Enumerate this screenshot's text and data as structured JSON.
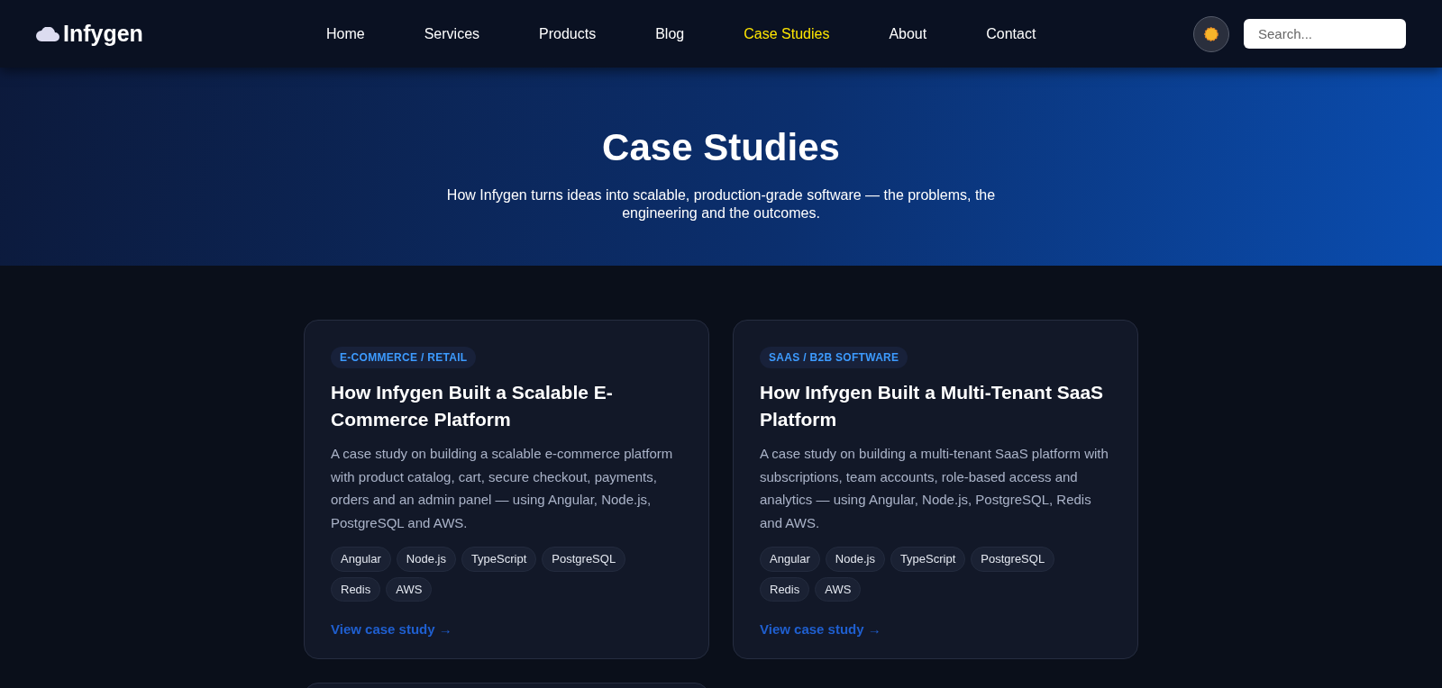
{
  "brand": {
    "name": "Infygen"
  },
  "nav": [
    {
      "label": "Home",
      "selected": false
    },
    {
      "label": "Services",
      "selected": false
    },
    {
      "label": "Products",
      "selected": false
    },
    {
      "label": "Blog",
      "selected": false
    },
    {
      "label": "Case Studies",
      "selected": true
    },
    {
      "label": "About",
      "selected": false
    },
    {
      "label": "Contact",
      "selected": false
    }
  ],
  "search": {
    "placeholder": "Search..."
  },
  "hero": {
    "title": "Case Studies",
    "subtitle": "How Infygen turns ideas into scalable, production-grade software — the problems, the engineering and the outcomes."
  },
  "cards": [
    {
      "category": "E-COMMERCE / RETAIL",
      "title": "How Infygen Built a Scalable E-Commerce Platform",
      "description": "A case study on building a scalable e-commerce platform with product catalog, cart, secure checkout, payments, orders and an admin panel — using Angular, Node.js, PostgreSQL and AWS.",
      "tags": [
        "Angular",
        "Node.js",
        "TypeScript",
        "PostgreSQL",
        "Redis",
        "AWS"
      ],
      "link": "View case study →"
    },
    {
      "category": "SAAS / B2B SOFTWARE",
      "title": "How Infygen Built a Multi-Tenant SaaS Platform",
      "description": "A case study on building a multi-tenant SaaS platform with subscriptions, team accounts, role-based access and analytics — using Angular, Node.js, PostgreSQL, Redis and AWS.",
      "tags": [
        "Angular",
        "Node.js",
        "TypeScript",
        "PostgreSQL",
        "Redis",
        "AWS"
      ],
      "link": "View case study →"
    }
  ]
}
